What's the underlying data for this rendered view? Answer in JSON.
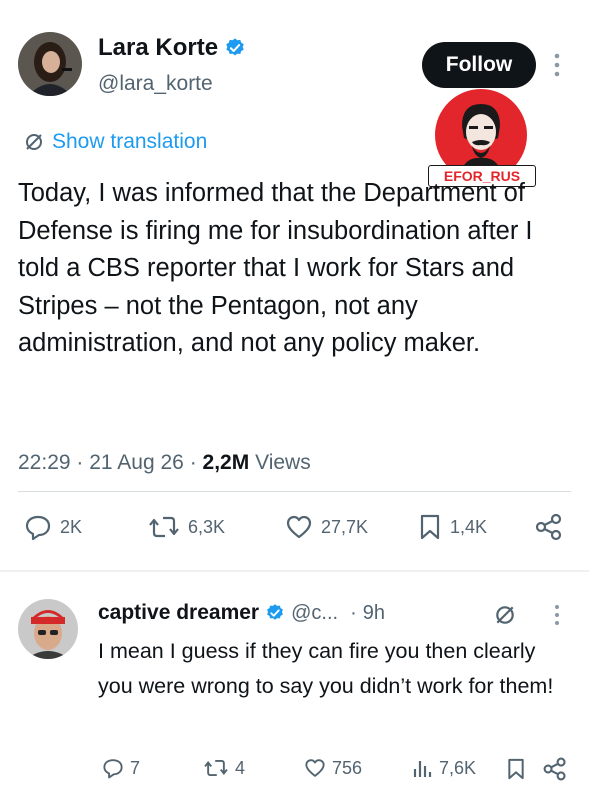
{
  "tweet": {
    "author_name": "Lara Korte",
    "author_handle": "@lara_korte",
    "follow_label": "Follow",
    "translation_label": "Show translation",
    "text": "Today, I was informed that the Department of Defense is firing me for insubordination after I told a CBS reporter that I work for Stars and Stripes – not the Pentagon, not any administration, and not any policy maker.",
    "time": "22:29",
    "date": "21 Aug 26",
    "separator": "·",
    "views_count": "2,2M",
    "views_label": "Views",
    "replies": "2K",
    "reposts": "6,3K",
    "likes": "27,7K",
    "bookmarks": "1,4K"
  },
  "watermark": {
    "label": "EFOR_RUS"
  },
  "reply": {
    "author_name": "captive dreamer",
    "author_handle": "@c...",
    "age": "9h",
    "separator": "·",
    "text": "I mean I guess if they can fire you then clearly you were wrong to say you didn’t work for them!",
    "replies": "7",
    "reposts": "4",
    "likes": "756",
    "views": "7,6K"
  },
  "colors": {
    "accent": "#1d9bf0",
    "text": "#0f1419",
    "muted": "#536471",
    "watermark_red": "#e3262c"
  }
}
